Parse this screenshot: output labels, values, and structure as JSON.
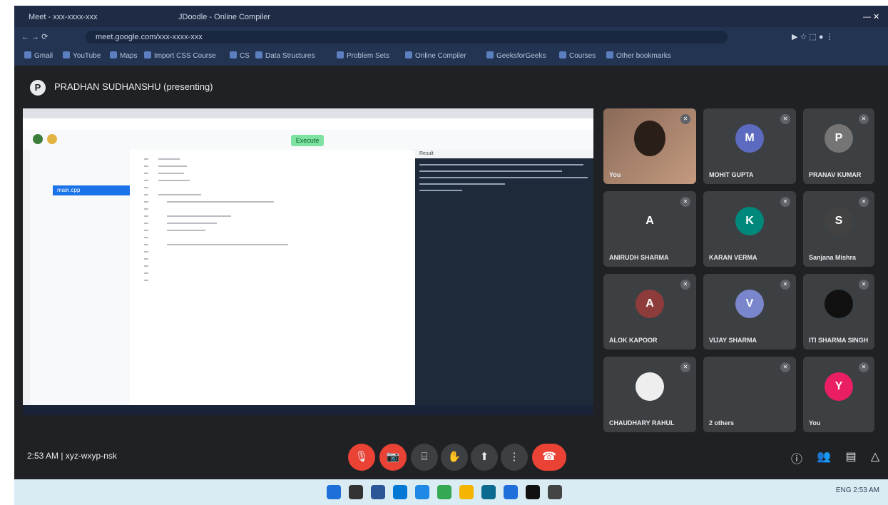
{
  "browser": {
    "tabs": [
      "Meet - xxx-xxxx-xxx",
      "JDoodle - Online Compiler"
    ],
    "url": "meet.google.com/xxx-xxxx-xxx",
    "bookmarks": [
      "Gmail",
      "YouTube",
      "Maps",
      "Import CSS Course",
      "CS",
      "Data Structures",
      "Problem Sets",
      "Online Compiler",
      "GeeksforGeeks",
      "Courses",
      "Other bookmarks"
    ]
  },
  "meet": {
    "presenter_initial": "P",
    "presenter_title": "PRADHAN SUDHANSHU (presenting)",
    "shared_screen": {
      "run_label": "Execute",
      "file_selected": "main.cpp",
      "console_title": "Result",
      "editor_line_count": 18
    },
    "participants": [
      {
        "name": "You",
        "initial": "",
        "color": "#7a5a4a",
        "is_video": true
      },
      {
        "name": "MOHIT GUPTA",
        "initial": "M",
        "color": "#5c6bc0"
      },
      {
        "name": "PRANAV KUMAR",
        "initial": "P",
        "color": "#757575"
      },
      {
        "name": "ANIRUDH SHARMA",
        "initial": "A",
        "color": "#3c4043"
      },
      {
        "name": "KARAN VERMA",
        "initial": "K",
        "color": "#00897b"
      },
      {
        "name": "Sanjana Mishra",
        "initial": "S",
        "color": "#424242"
      },
      {
        "name": "ALOK KAPOOR",
        "initial": "A",
        "color": "#8d3b3b"
      },
      {
        "name": "VIJAY SHARMA",
        "initial": "V",
        "color": "#7986cb"
      },
      {
        "name": "ITI SHARMA SINGH",
        "initial": "",
        "color": "#111111"
      },
      {
        "name": "CHAUDHARY RAHUL",
        "initial": "",
        "color": "#eeeeee"
      },
      {
        "name": "2 others",
        "initial": "",
        "color": "#3c4043"
      },
      {
        "name": "You",
        "initial": "Y",
        "color": "#e91e63"
      }
    ],
    "time_info": "2:53 AM  |  xyz-wxyp-nsk",
    "controls": [
      "mic-off",
      "camera-off",
      "captions",
      "raise-hand",
      "present",
      "more"
    ]
  },
  "taskbar": {
    "tray_text": "ENG   2:53 AM"
  }
}
